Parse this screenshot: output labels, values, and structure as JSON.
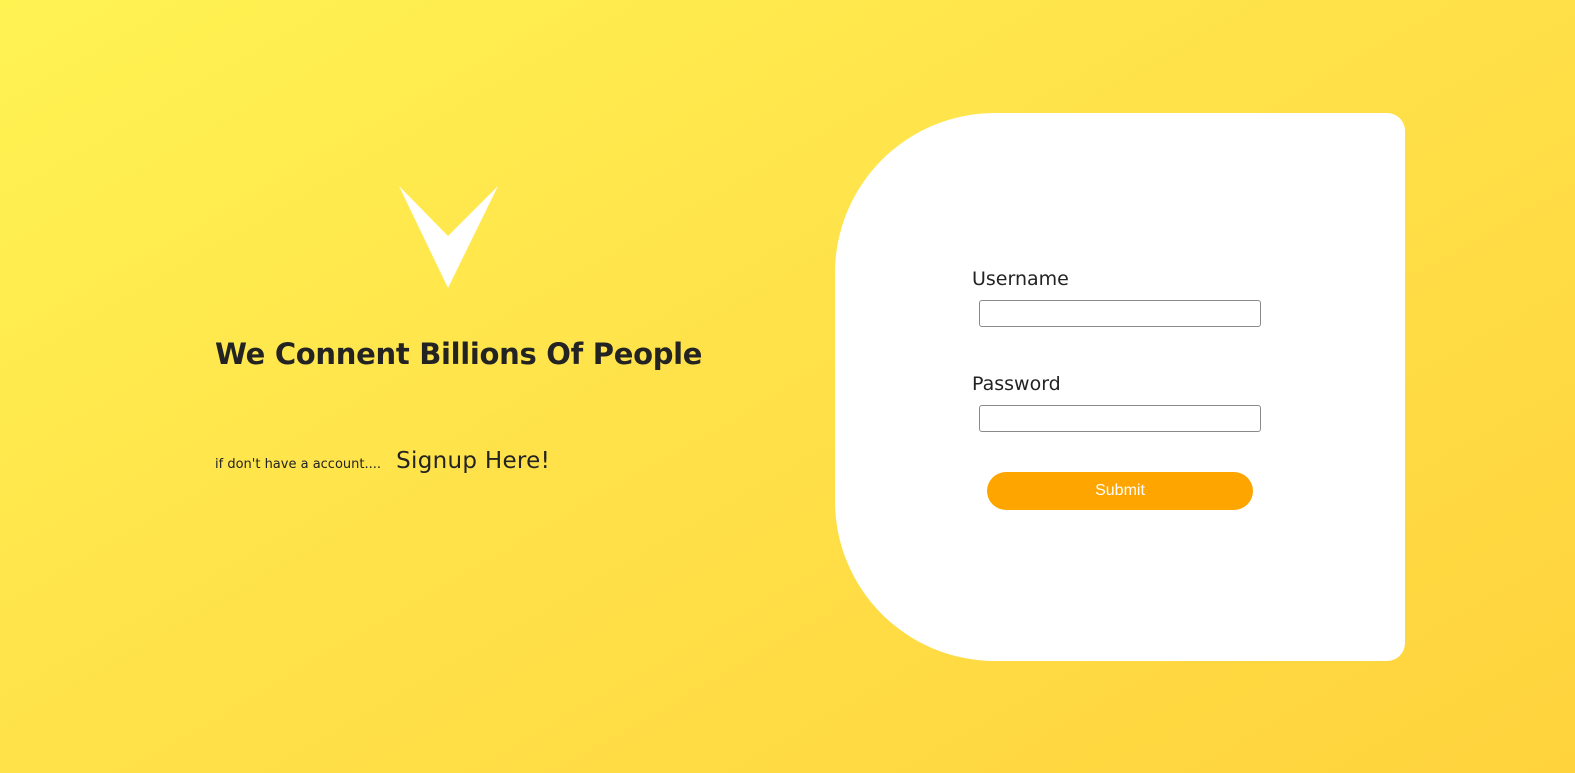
{
  "logo": {
    "icon": "chevron-v-logo-icon",
    "color": "#ffffff"
  },
  "hero": {
    "headline": "We Connent Billions Of People",
    "signup_prompt": "if don't have a account....",
    "signup_link": "Signup Here!"
  },
  "login_form": {
    "username_label": "Username",
    "username_value": "",
    "password_label": "Password",
    "password_value": "",
    "submit_label": "Submit"
  },
  "colors": {
    "background_start": "#fff352",
    "background_end": "#ffd33c",
    "card": "#ffffff",
    "submit_button": "#ffa500",
    "text": "#232323"
  }
}
